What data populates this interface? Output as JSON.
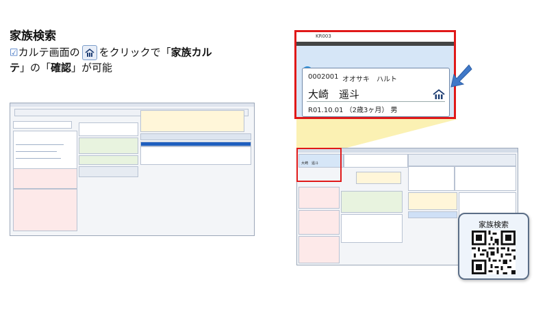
{
  "heading": "家族検索",
  "description": {
    "check": "☑",
    "part1": "カルテ画面の",
    "part2": "をクリックで「",
    "bold1": "家族カル",
    "part3": "テ",
    "part4": "」の「",
    "bold2": "確認",
    "part5": "」が可能"
  },
  "zoom_card": {
    "code": "KR003",
    "help_icon": "?",
    "patient_id": "0002001",
    "kana": "オオサキ　ハルト",
    "name": "大崎　遥斗",
    "dob_info": "R01.10.01 （2歳3ヶ月） 男",
    "family_icon": "family-house-icon"
  },
  "mini_card": {
    "name": "大崎　遥斗"
  },
  "qr_card": {
    "label": "家族検索"
  },
  "colors": {
    "accent_red": "#e01818",
    "arrow_blue": "#3f78c8",
    "highlight_yellow": "#fbf1b3"
  }
}
